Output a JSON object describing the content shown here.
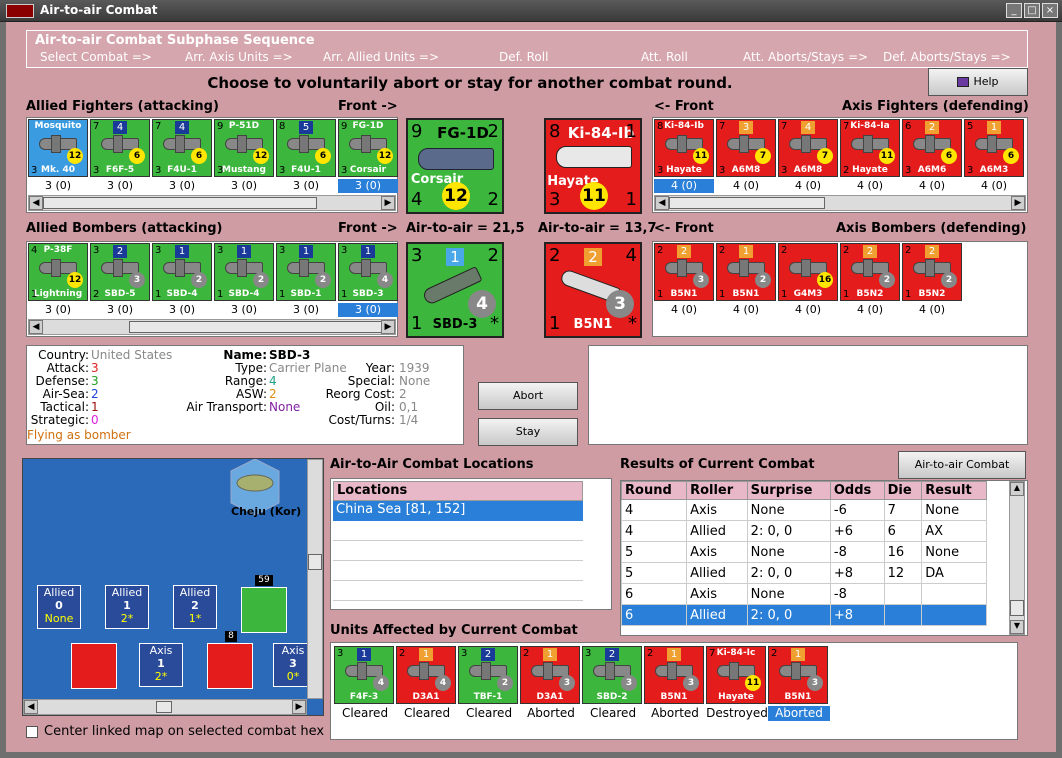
{
  "window": {
    "title": "Air-to-air Combat"
  },
  "sequence": {
    "title": "Air-to-air Combat Subphase Sequence",
    "steps": [
      "Select Combat =>",
      "Arr. Axis Units =>",
      "Arr. Allied Units =>",
      "Def. Roll",
      "Att. Roll",
      "Att. Aborts/Stays =>",
      "Def. Aborts/Stays =>"
    ]
  },
  "instruction": "Choose to voluntarily abort or stay for another combat round.",
  "help_label": "Help",
  "allied_fighters": {
    "header": "Allied Fighters (attacking)",
    "front": "Front ->",
    "units": [
      {
        "name": "Mosquito",
        "sub": "Mk. 40",
        "nation": "AUS",
        "tl": "",
        "cls": "",
        "tr": "",
        "bl": "3",
        "br": "1",
        "dot": "12",
        "count": "3 (0)",
        "color": "b"
      },
      {
        "name": "",
        "sub": "F6F-5",
        "tl": "7",
        "cls": "4",
        "tr": "",
        "bl": "3",
        "br": "",
        "dot": "6",
        "count": "3 (0)",
        "color": "g"
      },
      {
        "name": "",
        "sub": "F4U-1",
        "tl": "7",
        "cls": "4",
        "tr": "",
        "bl": "3",
        "br": "",
        "dot": "6",
        "count": "3 (0)",
        "color": "g"
      },
      {
        "name": "P-51D",
        "sub": "Mustang",
        "tl": "9",
        "cls": "",
        "tr": "",
        "bl": "3",
        "br": "",
        "dot": "12",
        "count": "3 (0)",
        "color": "g"
      },
      {
        "name": "",
        "sub": "F4U-1",
        "tl": "8",
        "cls": "5",
        "tr": "",
        "bl": "3",
        "br": "",
        "dot": "6",
        "count": "3 (0)",
        "color": "g"
      },
      {
        "name": "FG-1D",
        "sub": "Corsair",
        "tl": "9",
        "cls": "",
        "tr": "",
        "bl": "3",
        "br": "",
        "dot": "12",
        "count": "3 (0)",
        "color": "g"
      }
    ]
  },
  "allied_fighter_big": {
    "tl": "9",
    "name": "FG-1D",
    "tr": "2",
    "sub": "Corsair",
    "bl": "4",
    "dot": "12",
    "br": "2"
  },
  "axis_fighter_big": {
    "tl": "8",
    "name": "Ki-84-Ib",
    "tr": "1",
    "sub": "Hayate",
    "bl": "3",
    "dot": "11",
    "br": "1"
  },
  "axis_fighters": {
    "header": "Axis Fighters (defending)",
    "front": "<- Front",
    "units": [
      {
        "name": "Ki-84-Ib",
        "sub": "Hayate",
        "tl": "8",
        "cls": "",
        "bl": "3",
        "dot": "11",
        "count": "4 (0)"
      },
      {
        "name": "",
        "sub": "A6M8",
        "tl": "7",
        "cls": "3",
        "bl": "3",
        "dot": "7",
        "count": "4 (0)"
      },
      {
        "name": "",
        "sub": "A6M8",
        "tl": "7",
        "cls": "4",
        "bl": "3",
        "dot": "7",
        "count": "4 (0)"
      },
      {
        "name": "Ki-84-Ia",
        "sub": "Hayate",
        "tl": "7",
        "cls": "",
        "bl": "2",
        "dot": "11",
        "count": "4 (0)"
      },
      {
        "name": "",
        "sub": "A6M6",
        "tl": "6",
        "cls": "2",
        "bl": "3",
        "dot": "6",
        "count": "4 (0)"
      },
      {
        "name": "",
        "sub": "A6M3",
        "tl": "5",
        "cls": "1",
        "bl": "3",
        "dot": "6",
        "count": "4 (0)"
      }
    ]
  },
  "allied_bombers": {
    "header": "Allied Bombers (attacking)",
    "front": "Front ->",
    "air_to_air": "Air-to-air = 21,5",
    "units": [
      {
        "name": "P-38F",
        "sub": "Lightning",
        "tl": "4",
        "cls": "",
        "bl": "1",
        "dot": "12",
        "count": "3 (0)"
      },
      {
        "name": "",
        "sub": "SBD-5",
        "tl": "3",
        "cls": "2",
        "bl": "2",
        "dot": "3",
        "count": "3 (0)"
      },
      {
        "name": "",
        "sub": "SBD-4",
        "tl": "3",
        "cls": "1",
        "bl": "1",
        "dot": "2",
        "count": "3 (0)"
      },
      {
        "name": "",
        "sub": "SBD-4",
        "tl": "3",
        "cls": "1",
        "bl": "1",
        "dot": "2",
        "count": "3 (0)"
      },
      {
        "name": "",
        "sub": "SBD-1",
        "tl": "3",
        "cls": "1",
        "bl": "1",
        "dot": "2",
        "count": "3 (0)"
      },
      {
        "name": "",
        "sub": "SBD-3",
        "tl": "3",
        "cls": "1",
        "bl": "1",
        "dot": "4",
        "count": "3 (0)"
      }
    ]
  },
  "allied_bomber_big": {
    "tl": "3",
    "cls": "1",
    "tr": "2",
    "sub": "SBD-3",
    "bl": "1",
    "dot": "4",
    "br": "*"
  },
  "axis_bomber_big": {
    "tl": "2",
    "cls": "2",
    "tr": "4",
    "sub": "B5N1",
    "bl": "1",
    "dot": "3",
    "br": "*"
  },
  "axis_bombers": {
    "header": "Axis Bombers (defending)",
    "front": "<- Front",
    "air_to_air": "Air-to-air = 13,7",
    "units": [
      {
        "sub": "B5N1",
        "tl": "2",
        "cls": "2",
        "bl": "1",
        "dot": "3",
        "count": "4 (0)"
      },
      {
        "sub": "B5N1",
        "tl": "2",
        "cls": "1",
        "bl": "1",
        "dot": "2",
        "count": "4 (0)"
      },
      {
        "sub": "G4M3",
        "tl": "2",
        "cls": "",
        "bl": "1",
        "dot": "16",
        "count": "4 (0)"
      },
      {
        "sub": "B5N2",
        "tl": "2",
        "cls": "2",
        "bl": "1",
        "dot": "2",
        "count": "4 (0)"
      },
      {
        "sub": "B5N2",
        "tl": "2",
        "cls": "2",
        "bl": "1",
        "dot": "2",
        "count": "4 (0)"
      }
    ]
  },
  "unit_info": {
    "country_lbl": "Country:",
    "country": "United States",
    "attack_lbl": "Attack:",
    "attack": "3",
    "defense_lbl": "Defense:",
    "defense": "3",
    "airsea_lbl": "Air-Sea:",
    "airsea": "2",
    "tactical_lbl": "Tactical:",
    "tactical": "1",
    "strategic_lbl": "Strategic:",
    "strategic": "0",
    "flying": "Flying as bomber",
    "name_lbl": "Name:",
    "name": "SBD-3",
    "type_lbl": "Type:",
    "type": "Carrier Plane",
    "range_lbl": "Range:",
    "range": "4",
    "asw_lbl": "ASW:",
    "asw": "2",
    "transport_lbl": "Air Transport:",
    "transport": "None",
    "year_lbl": "Year:",
    "year": "1939",
    "special_lbl": "Special:",
    "special": "None",
    "reorg_lbl": "Reorg Cost:",
    "reorg": "2",
    "oil_lbl": "Oil:",
    "oil": "0,1",
    "cost_lbl": "Cost/Turns:",
    "cost": "1/4"
  },
  "abort_label": "Abort",
  "stay_label": "Stay",
  "map": {
    "hex_label": "Cheju (Kor)",
    "counters": [
      {
        "side": "Allied",
        "num": "0",
        "sub": "None"
      },
      {
        "side": "Allied",
        "num": "1",
        "sub": "2*"
      },
      {
        "side": "Allied",
        "num": "2",
        "sub": "1*"
      },
      {
        "side": "Axis",
        "num": "1",
        "sub": "2*"
      },
      {
        "side": "Axis",
        "num": "3",
        "sub": "0*"
      }
    ],
    "stack_a": "59",
    "stack_b": "8",
    "center_label": "Center linked map on selected combat hex"
  },
  "locations": {
    "title": "Air-to-Air Combat Locations",
    "header": "Locations",
    "items": [
      "China Sea [81, 152]"
    ]
  },
  "results": {
    "title": "Results of Current Combat",
    "chart_button": "Air-to-air Combat Chart",
    "headers": [
      "Round",
      "Roller",
      "Surprise",
      "Odds",
      "Die",
      "Result"
    ],
    "rows": [
      [
        "4",
        "Axis",
        "None",
        "-6",
        "7",
        "None"
      ],
      [
        "4",
        "Allied",
        "2: 0, 0",
        "+6",
        "6",
        "AX"
      ],
      [
        "5",
        "Axis",
        "None",
        "-8",
        "16",
        "None"
      ],
      [
        "5",
        "Allied",
        "2: 0, 0",
        "+8",
        "12",
        "DA"
      ],
      [
        "6",
        "Axis",
        "None",
        "-8",
        "",
        ""
      ],
      [
        "6",
        "Allied",
        "2: 0, 0",
        "+8",
        "",
        ""
      ]
    ]
  },
  "affected": {
    "title": "Units Affected by Current Combat",
    "units": [
      {
        "sub": "F4F-3",
        "tl": "3",
        "cls": "1",
        "dot": "4",
        "color": "g",
        "status": "Cleared"
      },
      {
        "sub": "D3A1",
        "tl": "2",
        "cls": "1",
        "dot": "4",
        "color": "r",
        "status": "Cleared"
      },
      {
        "sub": "TBF-1",
        "tl": "3",
        "cls": "2",
        "dot": "2",
        "color": "g",
        "status": "Cleared"
      },
      {
        "sub": "D3A1",
        "tl": "2",
        "cls": "1",
        "dot": "3",
        "color": "r",
        "status": "Aborted"
      },
      {
        "sub": "SBD-2",
        "tl": "3",
        "cls": "2",
        "dot": "3",
        "color": "g",
        "status": "Cleared"
      },
      {
        "sub": "B5N1",
        "tl": "2",
        "cls": "1",
        "dot": "3",
        "color": "r",
        "status": "Aborted"
      },
      {
        "sub": "Hayate",
        "name": "Ki-84-Ic",
        "tl": "7",
        "cls": "",
        "dot": "11",
        "color": "r",
        "status": "Destroyed"
      },
      {
        "sub": "B5N1",
        "tl": "2",
        "cls": "1",
        "dot": "3",
        "color": "r",
        "status": "Aborted"
      }
    ]
  }
}
